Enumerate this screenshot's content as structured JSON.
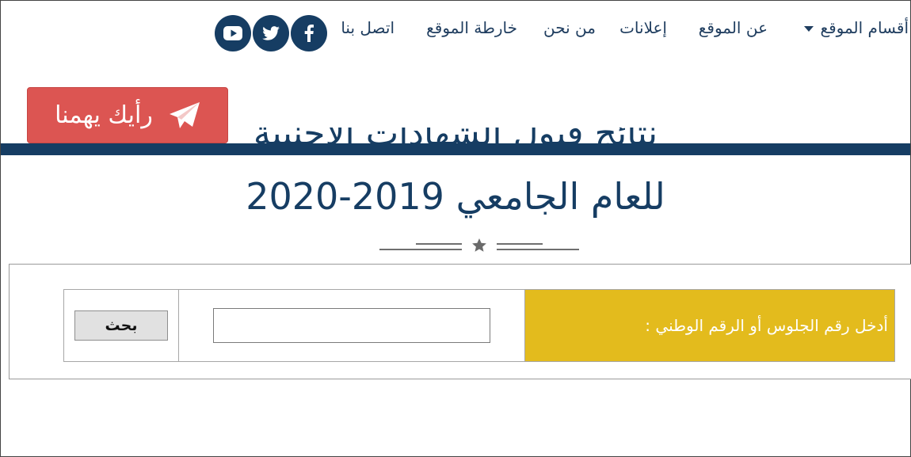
{
  "nav": {
    "sections": "أقسام الموقع",
    "about_site": "عن الموقع",
    "ads": "إعلانات",
    "who_we_are": "من نحن",
    "sitemap": "خارطة الموقع",
    "contact": "اتصل بنا"
  },
  "social": {
    "facebook": "facebook-icon",
    "twitter": "twitter-icon",
    "youtube": "youtube-icon"
  },
  "feedback": {
    "label": "رأيك يهمنا",
    "icon": "paper-plane-icon"
  },
  "title": {
    "line1": "نتائج قبول الشهادات الأجنبية",
    "line2": "للعام الجامعي 2019-2020"
  },
  "search": {
    "prompt": "أدخل رقم الجلوس أو الرقم الوطني :",
    "input_value": "",
    "button_label": "بحث"
  },
  "colors": {
    "primary": "#163d63",
    "feedback": "#dc5552",
    "label_bg": "#e3bb1d"
  }
}
